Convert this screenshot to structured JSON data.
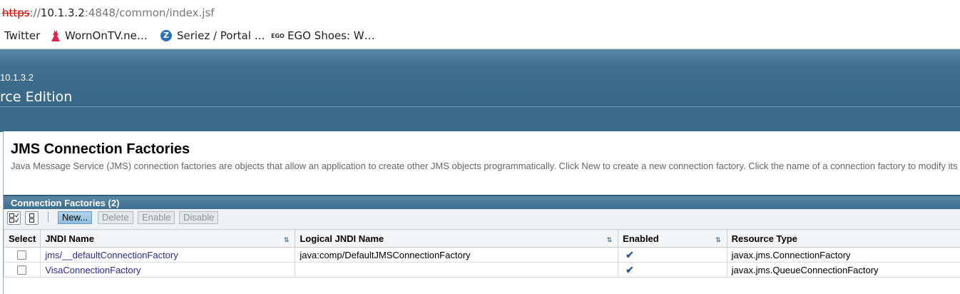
{
  "browser": {
    "url_proto": "https",
    "url_sep": "://",
    "url_host": "10.1.3.2",
    "url_rest": ":4848/common/index.jsf",
    "bookmarks": [
      {
        "label": "Twitter",
        "icon": "twitter-icon"
      },
      {
        "label": "WornOnTV.ne…",
        "icon": "dress-icon"
      },
      {
        "label": "Seriez / Portal …",
        "icon": "z-icon",
        "icon_text": "Z"
      },
      {
        "label": "EGO Shoes: W…",
        "icon": "ego-icon",
        "icon_text": "EGO"
      }
    ]
  },
  "header": {
    "host": "10.1.3.2",
    "edition": "rce Edition"
  },
  "page": {
    "title": "JMS Connection Factories",
    "help": "Java Message Service (JMS) connection factories are objects that allow an application to create other JMS objects programmatically. Click New to create a new connection factory. Click the name of a connection factory to modify its"
  },
  "table": {
    "title": "Connection Factories (2)",
    "buttons": {
      "new": "New...",
      "delete": "Delete",
      "enable": "Enable",
      "disable": "Disable"
    },
    "columns": [
      "Select",
      "JNDI Name",
      "Logical JNDI Name",
      "Enabled",
      "Resource Type"
    ],
    "sort_glyph": "⇅",
    "check_glyph": "✔",
    "rows": [
      {
        "jndi": "jms/__defaultConnectionFactory",
        "logical": "java:comp/DefaultJMSConnectionFactory",
        "enabled": true,
        "type": "javax.jms.ConnectionFactory"
      },
      {
        "jndi": "VisaConnectionFactory",
        "logical": "",
        "enabled": true,
        "type": "javax.jms.QueueConnectionFactory"
      }
    ]
  },
  "colors": {
    "header": "#386888",
    "link": "#2a2aa0",
    "accent_button": "#8fbde0"
  }
}
